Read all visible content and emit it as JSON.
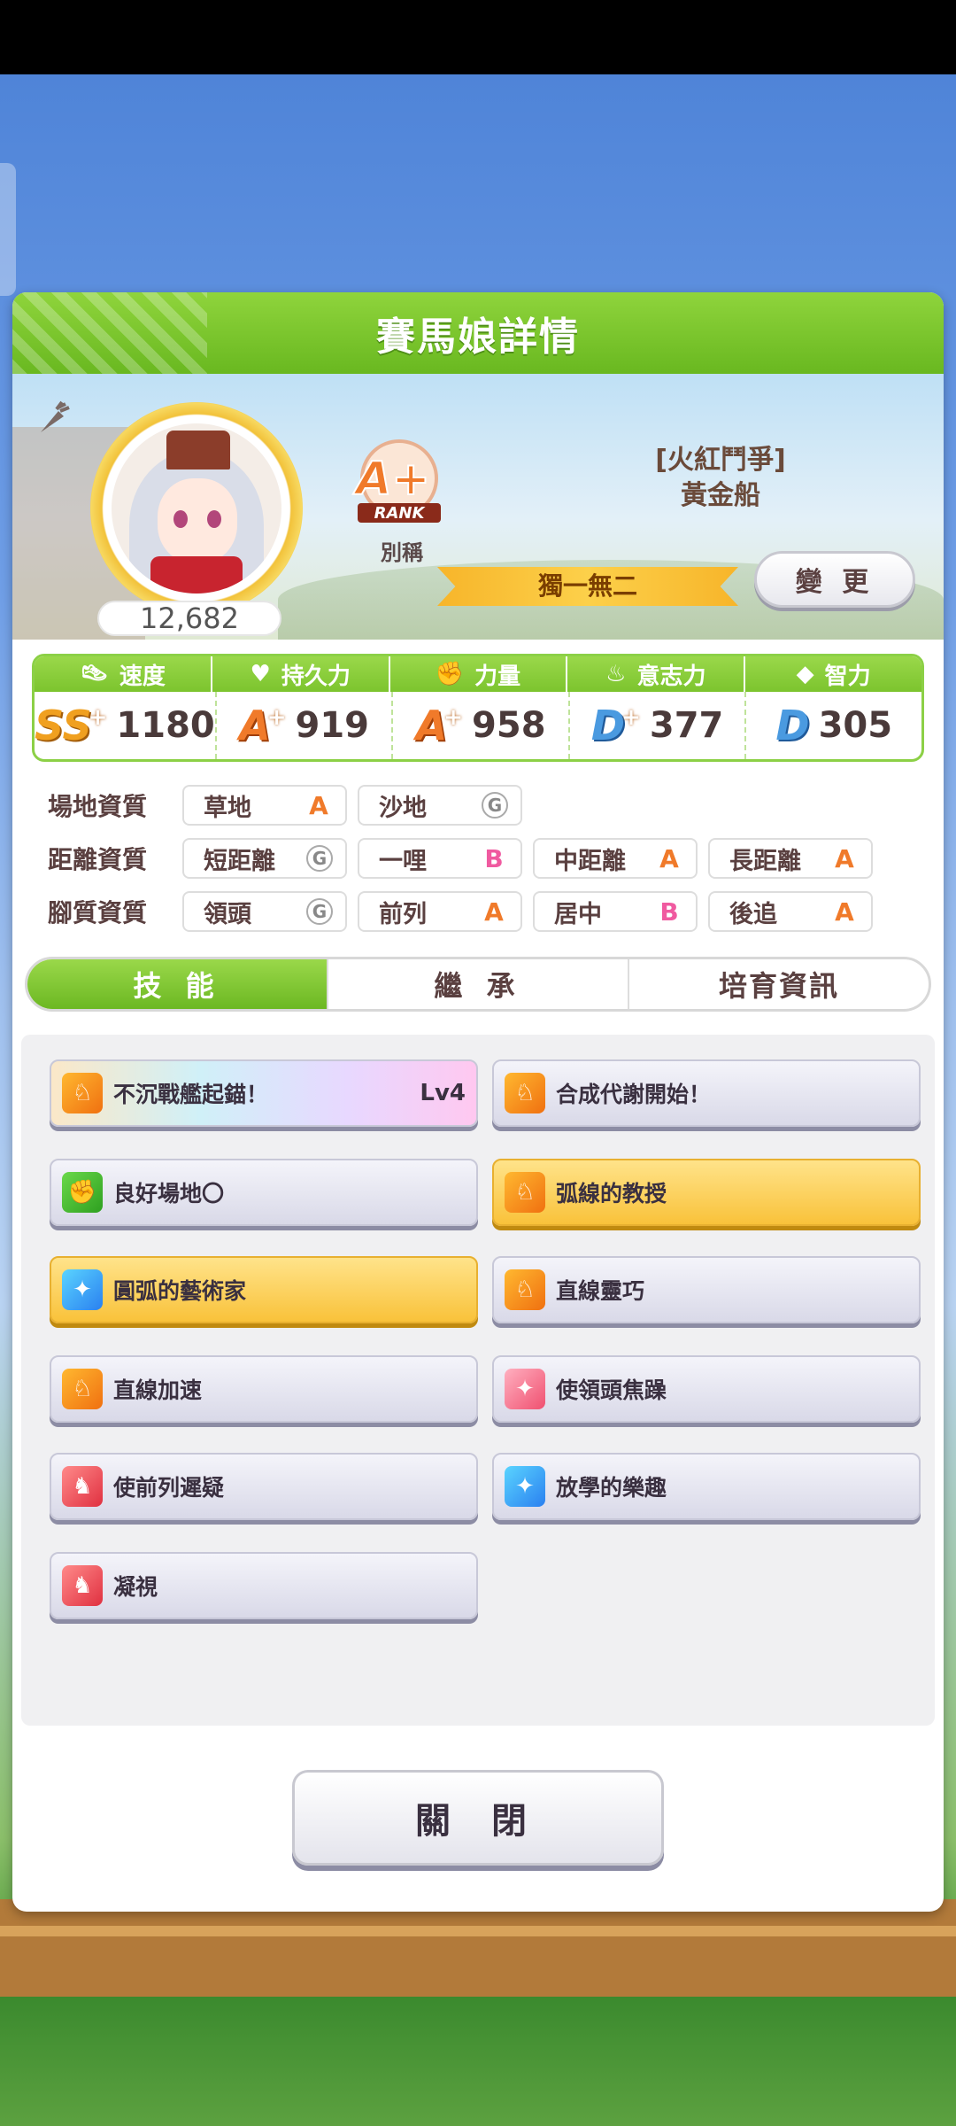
{
  "dialog": {
    "title": "賽馬娘詳情"
  },
  "profile": {
    "fans": "12,682",
    "rank_label": "RANK",
    "rank_grade": "A+",
    "rank_caption": "別稱",
    "epithet": "[火紅鬥爭]",
    "name": "黃金船",
    "alias": "獨一無二",
    "change_button": "變 更"
  },
  "stats": {
    "items": [
      {
        "label": "速度",
        "grade": "SS",
        "plus": "+",
        "value": "1180",
        "icon": "shoe-icon"
      },
      {
        "label": "持久力",
        "grade": "A",
        "plus": "+",
        "value": "919",
        "icon": "heart-icon"
      },
      {
        "label": "力量",
        "grade": "A",
        "plus": "+",
        "value": "958",
        "icon": "muscle-icon"
      },
      {
        "label": "意志力",
        "grade": "D",
        "plus": "+",
        "value": "377",
        "icon": "flame-icon"
      },
      {
        "label": "智力",
        "grade": "D",
        "plus": "",
        "value": "305",
        "icon": "graduation-cap-icon"
      }
    ]
  },
  "aptitudes": {
    "rows": [
      {
        "label": "場地資質",
        "cells": [
          {
            "name": "草地",
            "grade": "A"
          },
          {
            "name": "沙地",
            "grade": "G"
          }
        ]
      },
      {
        "label": "距離資質",
        "cells": [
          {
            "name": "短距離",
            "grade": "G"
          },
          {
            "name": "一哩",
            "grade": "B"
          },
          {
            "name": "中距離",
            "grade": "A"
          },
          {
            "name": "長距離",
            "grade": "A"
          }
        ]
      },
      {
        "label": "腳質資質",
        "cells": [
          {
            "name": "領頭",
            "grade": "G"
          },
          {
            "name": "前列",
            "grade": "A"
          },
          {
            "name": "居中",
            "grade": "B"
          },
          {
            "name": "後追",
            "grade": "A"
          }
        ]
      }
    ]
  },
  "tabs": [
    {
      "label": "技 能",
      "active": true
    },
    {
      "label": "繼 承",
      "active": false
    },
    {
      "label": "培育資訊",
      "active": false
    }
  ],
  "skills": [
    {
      "name": "不沉戰艦起錨！",
      "level": "Lv4",
      "style": "rainbow",
      "icon_color": "orange",
      "icon": "running-horse-icon"
    },
    {
      "name": "合成代謝開始！",
      "level": "",
      "style": "normal",
      "icon_color": "orange",
      "icon": "running-horse-icon"
    },
    {
      "name": "良好場地〇",
      "level": "",
      "style": "normal",
      "icon_color": "green",
      "icon": "muscle-icon"
    },
    {
      "name": "弧線的教授",
      "level": "",
      "style": "gold",
      "icon_color": "orange",
      "icon": "running-horse-icon"
    },
    {
      "name": "圓弧的藝術家",
      "level": "",
      "style": "gold",
      "icon_color": "blue",
      "icon": "sparkle-icon"
    },
    {
      "name": "直線靈巧",
      "level": "",
      "style": "normal",
      "icon_color": "orange",
      "icon": "running-horse-icon"
    },
    {
      "name": "直線加速",
      "level": "",
      "style": "normal",
      "icon_color": "orange",
      "icon": "running-horse-icon"
    },
    {
      "name": "使領頭焦躁",
      "level": "",
      "style": "normal",
      "icon_color": "pink",
      "icon": "sparkle-icon"
    },
    {
      "name": "使前列遲疑",
      "level": "",
      "style": "normal",
      "icon_color": "red",
      "icon": "horse-down-icon"
    },
    {
      "name": "放學的樂趣",
      "level": "",
      "style": "normal",
      "icon_color": "blue",
      "icon": "sparkle-icon"
    },
    {
      "name": "凝視",
      "level": "",
      "style": "normal",
      "icon_color": "red",
      "icon": "horse-down-icon"
    }
  ],
  "close_button": "關 閉"
}
